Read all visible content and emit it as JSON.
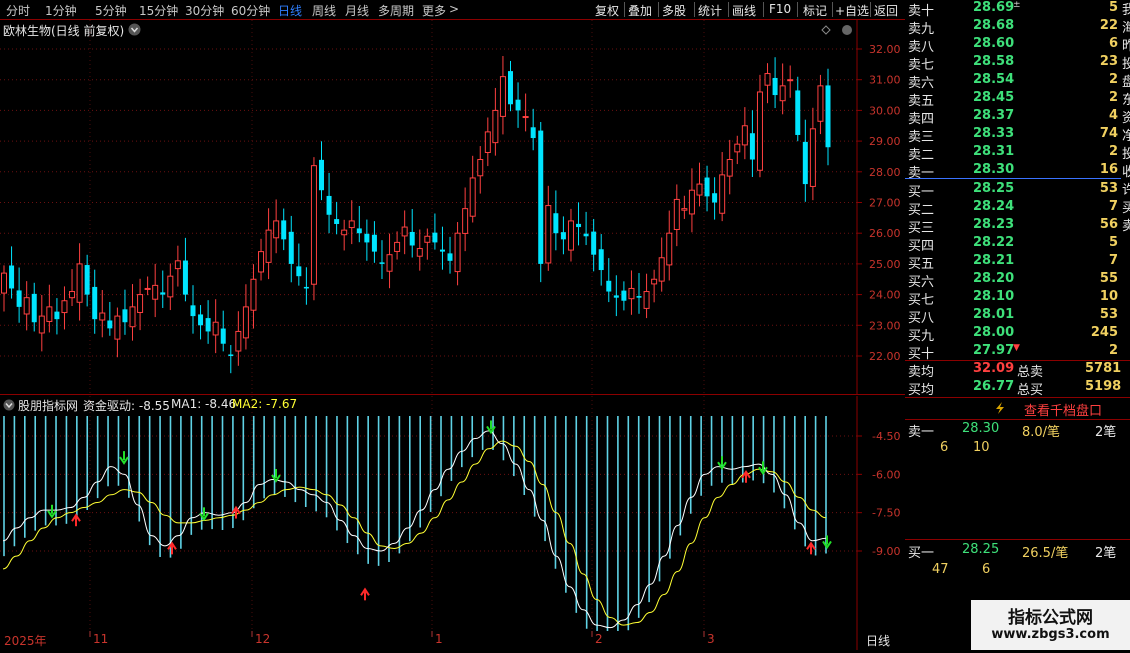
{
  "toolbar": {
    "periods": [
      "分时",
      "1分钟",
      "5分钟",
      "15分钟",
      "30分钟",
      "60分钟",
      "日线",
      "周线",
      "月线",
      "多周期",
      "更多"
    ],
    "active_period": "日线",
    "more_arrow": ">",
    "buttons": [
      "复权",
      "叠加",
      "多股",
      "统计",
      "画线",
      "F10",
      "标记",
      "+自选",
      "返回"
    ]
  },
  "kline": {
    "title": "欧林生物(日线 前复权)",
    "price_ticks": [
      "32.00",
      "31.00",
      "30.00",
      "29.00",
      "28.00",
      "27.00",
      "26.00",
      "25.00",
      "24.00",
      "23.00",
      "22.00"
    ],
    "up_color": "#ff4040",
    "down_color": "#00e5ff"
  },
  "indicator": {
    "name": "股朋指标网",
    "line1": "资金驱动: -8.55",
    "line2": "MA1: -8.46",
    "line3": "MA2: -7.67",
    "ticks": [
      "-4.50",
      "-6.00",
      "-7.50",
      "-9.00"
    ],
    "ma1_color": "#ffffff",
    "ma2_color": "#ffff33"
  },
  "date_axis": {
    "labels": [
      "2025年",
      "11",
      "12",
      "1",
      "2",
      "3"
    ],
    "period": "日线"
  },
  "orderbook": {
    "sells": [
      {
        "name": "卖十",
        "price": "28.69",
        "vol": "5",
        "mark": "±"
      },
      {
        "name": "卖九",
        "price": "28.68",
        "vol": "22"
      },
      {
        "name": "卖八",
        "price": "28.60",
        "vol": "6"
      },
      {
        "name": "卖七",
        "price": "28.58",
        "vol": "23"
      },
      {
        "name": "卖六",
        "price": "28.54",
        "vol": "2"
      },
      {
        "name": "卖五",
        "price": "28.45",
        "vol": "2"
      },
      {
        "name": "卖四",
        "price": "28.37",
        "vol": "4"
      },
      {
        "name": "卖三",
        "price": "28.33",
        "vol": "74"
      },
      {
        "name": "卖二",
        "price": "28.31",
        "vol": "2"
      },
      {
        "name": "卖一",
        "price": "28.30",
        "vol": "16"
      }
    ],
    "buys": [
      {
        "name": "买一",
        "price": "28.25",
        "vol": "53"
      },
      {
        "name": "买二",
        "price": "28.24",
        "vol": "7"
      },
      {
        "name": "买三",
        "price": "28.23",
        "vol": "56"
      },
      {
        "name": "买四",
        "price": "28.22",
        "vol": "5"
      },
      {
        "name": "买五",
        "price": "28.21",
        "vol": "7"
      },
      {
        "name": "买六",
        "price": "28.20",
        "vol": "55"
      },
      {
        "name": "买七",
        "price": "28.10",
        "vol": "10"
      },
      {
        "name": "买八",
        "price": "28.01",
        "vol": "53"
      },
      {
        "name": "买九",
        "price": "28.00",
        "vol": "245"
      },
      {
        "name": "买十",
        "price": "27.97",
        "vol": "2",
        "mark": "▼"
      }
    ],
    "avg_sell_label": "卖均",
    "avg_sell_price": "32.09",
    "total_sell_label": "总卖",
    "total_sell": "5781",
    "avg_buy_label": "买均",
    "avg_buy_price": "26.77",
    "total_buy_label": "总买",
    "total_buy": "5198",
    "thousand_btn": "查看千档盘口",
    "ask1_label": "卖一",
    "ask1_price": "28.30",
    "ask1_avg": "8.0/笔",
    "ask1_count": "2笔",
    "ask1_q1": "6",
    "ask1_q2": "10",
    "bid1_label": "买一",
    "bid1_price": "28.25",
    "bid1_avg": "26.5/笔",
    "bid1_count": "2笔",
    "bid1_q1": "47",
    "bid1_q2": "6",
    "side_cut_text": "我海昨投盘东资净投收许买卖",
    "watermark_main": "指标公式网",
    "watermark_url": "www.zbgs3.com"
  }
}
